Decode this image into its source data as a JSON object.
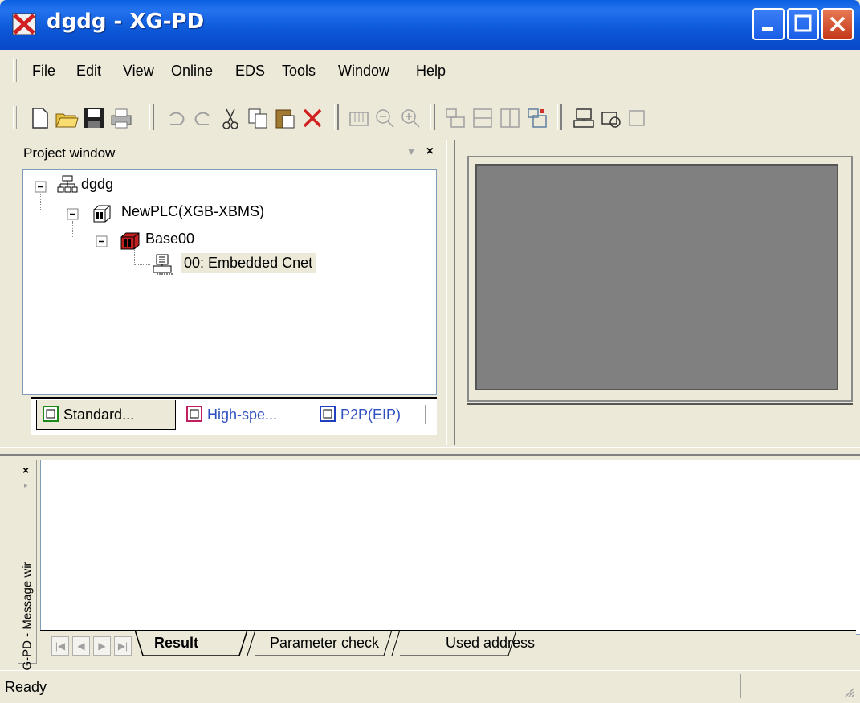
{
  "window": {
    "title": "dgdg - XG-PD"
  },
  "menu": {
    "items": [
      "File",
      "Edit",
      "View",
      "Online",
      "EDS",
      "Tools",
      "Window",
      "Help"
    ]
  },
  "toolbar": {
    "icons": [
      "new-icon",
      "open-icon",
      "save-icon",
      "print-icon",
      "undo-icon",
      "redo-icon",
      "cut-icon",
      "copy-icon",
      "paste-icon",
      "delete-icon",
      "scan-icon",
      "zoom-out-icon",
      "zoom-in-icon",
      "layout-icon",
      "split-h-icon",
      "split-v-icon",
      "window-icon",
      "network-icon",
      "config-icon"
    ]
  },
  "project": {
    "title": "Project window",
    "tree": {
      "root": "dgdg",
      "plc": "NewPLC(XGB-XBMS)",
      "base": "Base00",
      "module": "00: Embedded Cnet"
    },
    "tabs": [
      "Standard...",
      "High-spe...",
      "P2P(EIP)"
    ]
  },
  "message": {
    "side_title": "XG-PD - Message wir",
    "tabs": [
      "Result",
      "Parameter check",
      "Used address"
    ]
  },
  "status": {
    "text": "Ready"
  },
  "colors": {
    "title_bar": "#0a5fe0",
    "workspace_gray": "#808080",
    "chrome": "#ece9d8"
  }
}
